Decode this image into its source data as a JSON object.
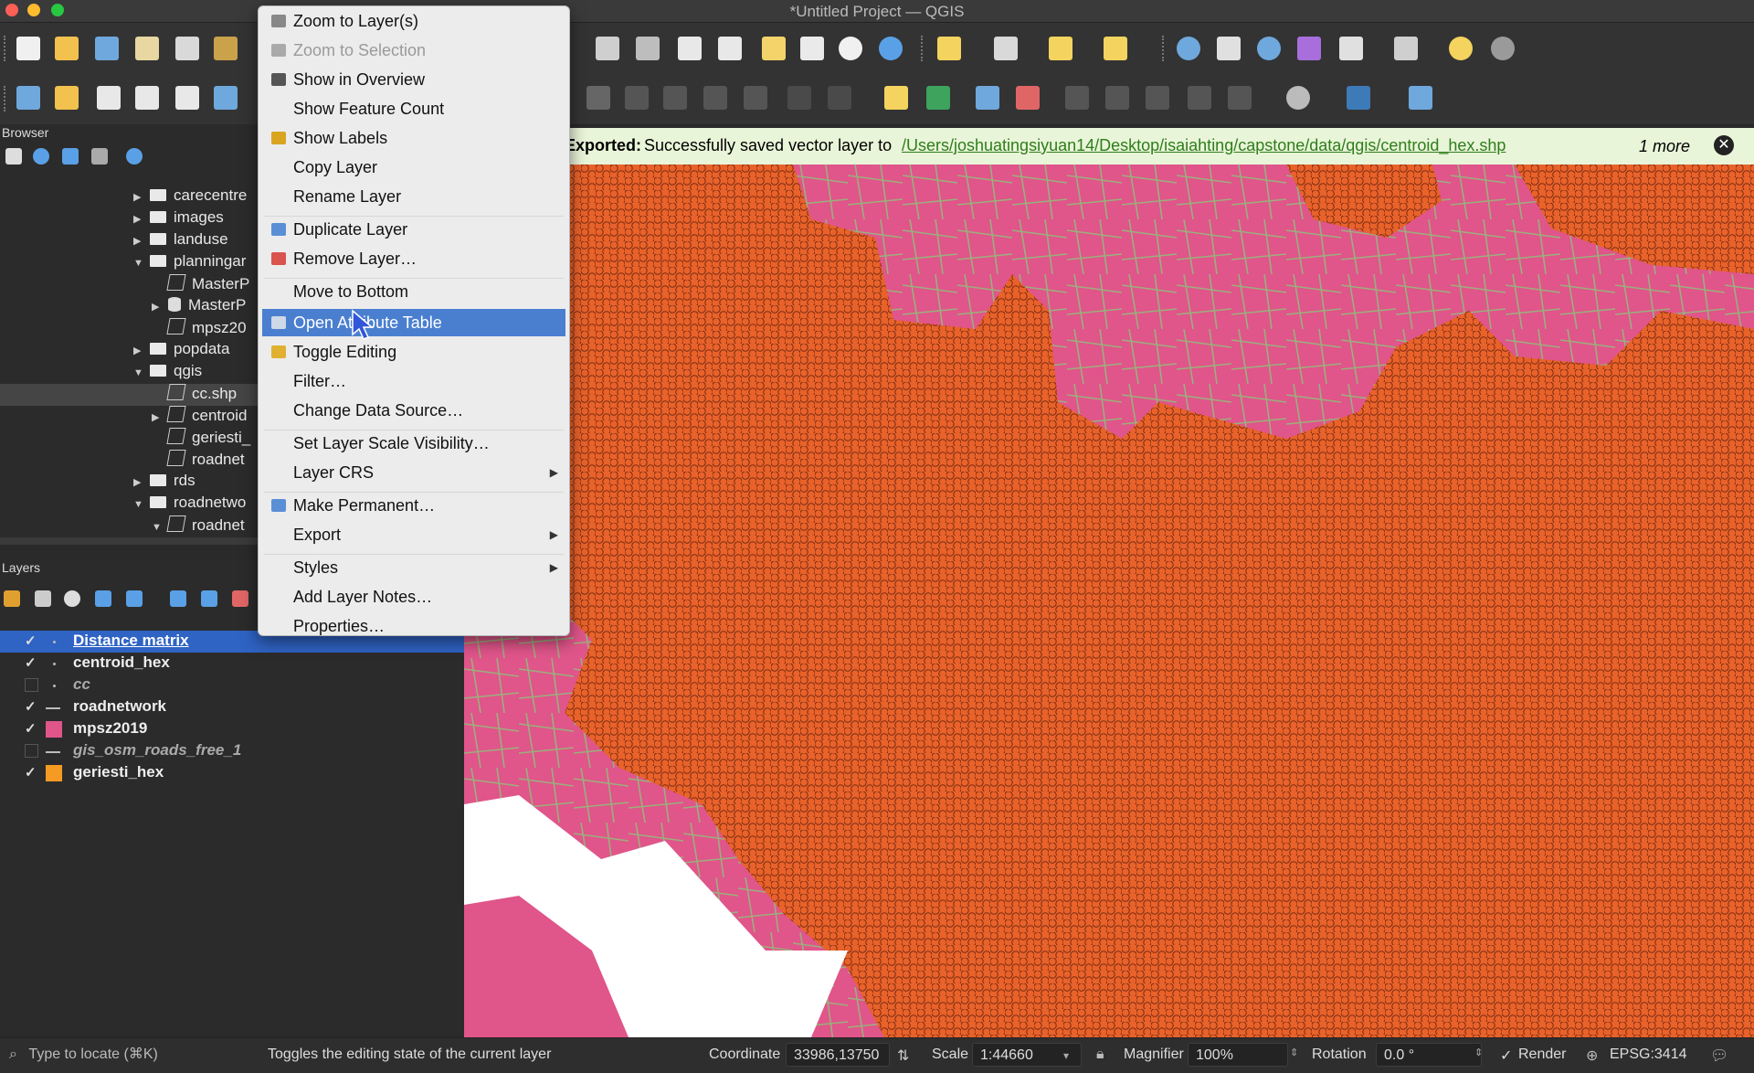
{
  "window": {
    "title": "*Untitled Project — QGIS"
  },
  "browser": {
    "title": "Browser",
    "items": [
      {
        "label": "carecentre",
        "type": "folder",
        "expanded": false
      },
      {
        "label": "images",
        "type": "folder",
        "expanded": false
      },
      {
        "label": "landuse",
        "type": "folder",
        "expanded": false
      },
      {
        "label": "planningar",
        "type": "folder",
        "expanded": true
      },
      {
        "label": "MasterP",
        "type": "layer"
      },
      {
        "label": "MasterP",
        "type": "db",
        "expanded": false
      },
      {
        "label": "mpsz20",
        "type": "layer"
      },
      {
        "label": "popdata",
        "type": "folder",
        "expanded": false
      },
      {
        "label": "qgis",
        "type": "folder",
        "expanded": true
      },
      {
        "label": "cc.shp",
        "type": "layer",
        "selected": true
      },
      {
        "label": "centroid",
        "type": "layer",
        "expanded": false
      },
      {
        "label": "geriesti_",
        "type": "layer"
      },
      {
        "label": "roadnet",
        "type": "layer"
      },
      {
        "label": "rds",
        "type": "folder",
        "expanded": false
      },
      {
        "label": "roadnetwo",
        "type": "folder",
        "expanded": true
      },
      {
        "label": "roadnet",
        "type": "layer",
        "expanded": true
      }
    ]
  },
  "layers": {
    "title": "Layers",
    "items": [
      {
        "name": "Distance matrix",
        "checked": true,
        "symbol": "point",
        "selected": true
      },
      {
        "name": "centroid_hex",
        "checked": true,
        "symbol": "point"
      },
      {
        "name": "cc",
        "checked": false,
        "symbol": "point"
      },
      {
        "name": "roadnetwork",
        "checked": true,
        "symbol": "line"
      },
      {
        "name": "mpsz2019",
        "checked": true,
        "symbol": "polygon",
        "color": "#e0558a"
      },
      {
        "name": "gis_osm_roads_free_1",
        "checked": false,
        "symbol": "line"
      },
      {
        "name": "geriesti_hex",
        "checked": true,
        "symbol": "polygon",
        "color": "#f59a23"
      }
    ]
  },
  "context_menu": {
    "items": [
      {
        "label": "Zoom to Layer(s)",
        "icon": "zoom-layer-icon"
      },
      {
        "label": "Zoom to Selection",
        "icon": "zoom-selection-icon",
        "disabled": true
      },
      {
        "label": "Show in Overview",
        "icon": "overview-icon"
      },
      {
        "label": "Show Feature Count",
        "icon": ""
      },
      {
        "label": "Show Labels",
        "icon": "labels-icon"
      },
      {
        "label": "Copy Layer",
        "icon": ""
      },
      {
        "label": "Rename Layer",
        "icon": ""
      },
      {
        "label": "Duplicate Layer",
        "icon": "duplicate-icon"
      },
      {
        "label": "Remove Layer…",
        "icon": "remove-icon"
      },
      {
        "label": "Move to Bottom",
        "icon": ""
      },
      {
        "label": "Open Attribute Table",
        "icon": "table-icon",
        "highlighted": true
      },
      {
        "label": "Toggle Editing",
        "icon": "pencil-icon"
      },
      {
        "label": "Filter…",
        "icon": ""
      },
      {
        "label": "Change Data Source…",
        "icon": ""
      },
      {
        "label": "Set Layer Scale Visibility…",
        "icon": ""
      },
      {
        "label": "Layer CRS",
        "icon": "",
        "submenu": true
      },
      {
        "label": "Make Permanent…",
        "icon": "save-icon"
      },
      {
        "label": "Export",
        "icon": "",
        "submenu": true
      },
      {
        "label": "Styles",
        "icon": "",
        "submenu": true
      },
      {
        "label": "Add Layer Notes…",
        "icon": ""
      },
      {
        "label": "Properties…",
        "icon": ""
      }
    ]
  },
  "message_bar": {
    "prefix": "Exported:",
    "text": "Successfully saved vector layer to",
    "link": "/Users/joshuatingsiyuan14/Desktop/isaiahting/capstone/data/qgis/centroid_hex.shp",
    "more": "1 more"
  },
  "statusbar": {
    "locate_placeholder": "Type to locate (⌘K)",
    "hint": "Toggles the editing state of the current layer",
    "coordinate_label": "Coordinate",
    "coordinate_value": "33986,13750",
    "scale_label": "Scale",
    "scale_value": "1:44660",
    "magnifier_label": "Magnifier",
    "magnifier_value": "100%",
    "rotation_label": "Rotation",
    "rotation_value": "0.0 °",
    "render_label": "Render",
    "crs": "EPSG:3414"
  },
  "colors": {
    "map_polygon": "#e0558a",
    "hex_fill": "#e8622a",
    "roads": "#8fbf7a",
    "menu_highlight": "#4a7fd0"
  }
}
